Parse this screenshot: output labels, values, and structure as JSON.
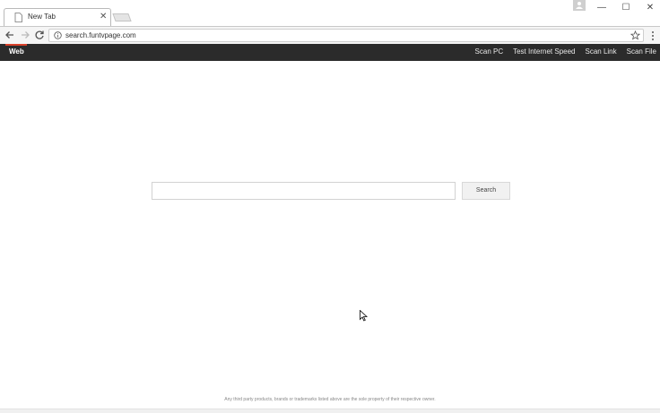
{
  "browser": {
    "tab_title": "New Tab",
    "url": "search.funtvpage.com"
  },
  "sitebar": {
    "active": "Web",
    "links": [
      "Scan PC",
      "Test Internet Speed",
      "Scan Link",
      "Scan File"
    ]
  },
  "search": {
    "input_value": "",
    "button_label": "Search"
  },
  "footer": {
    "disclaimer": "Any third party products, brands or trademarks listed above are the sole property of their respective owner."
  },
  "colors": {
    "sitebar_bg": "#2b2b2b",
    "accent": "#d9412b"
  },
  "icons": [
    "page-icon",
    "close-icon",
    "profile-icon",
    "minimize-icon",
    "maximize-icon",
    "window-close-icon",
    "back-icon",
    "forward-icon",
    "reload-icon",
    "info-icon",
    "star-icon",
    "menu-icon",
    "cursor-icon"
  ]
}
